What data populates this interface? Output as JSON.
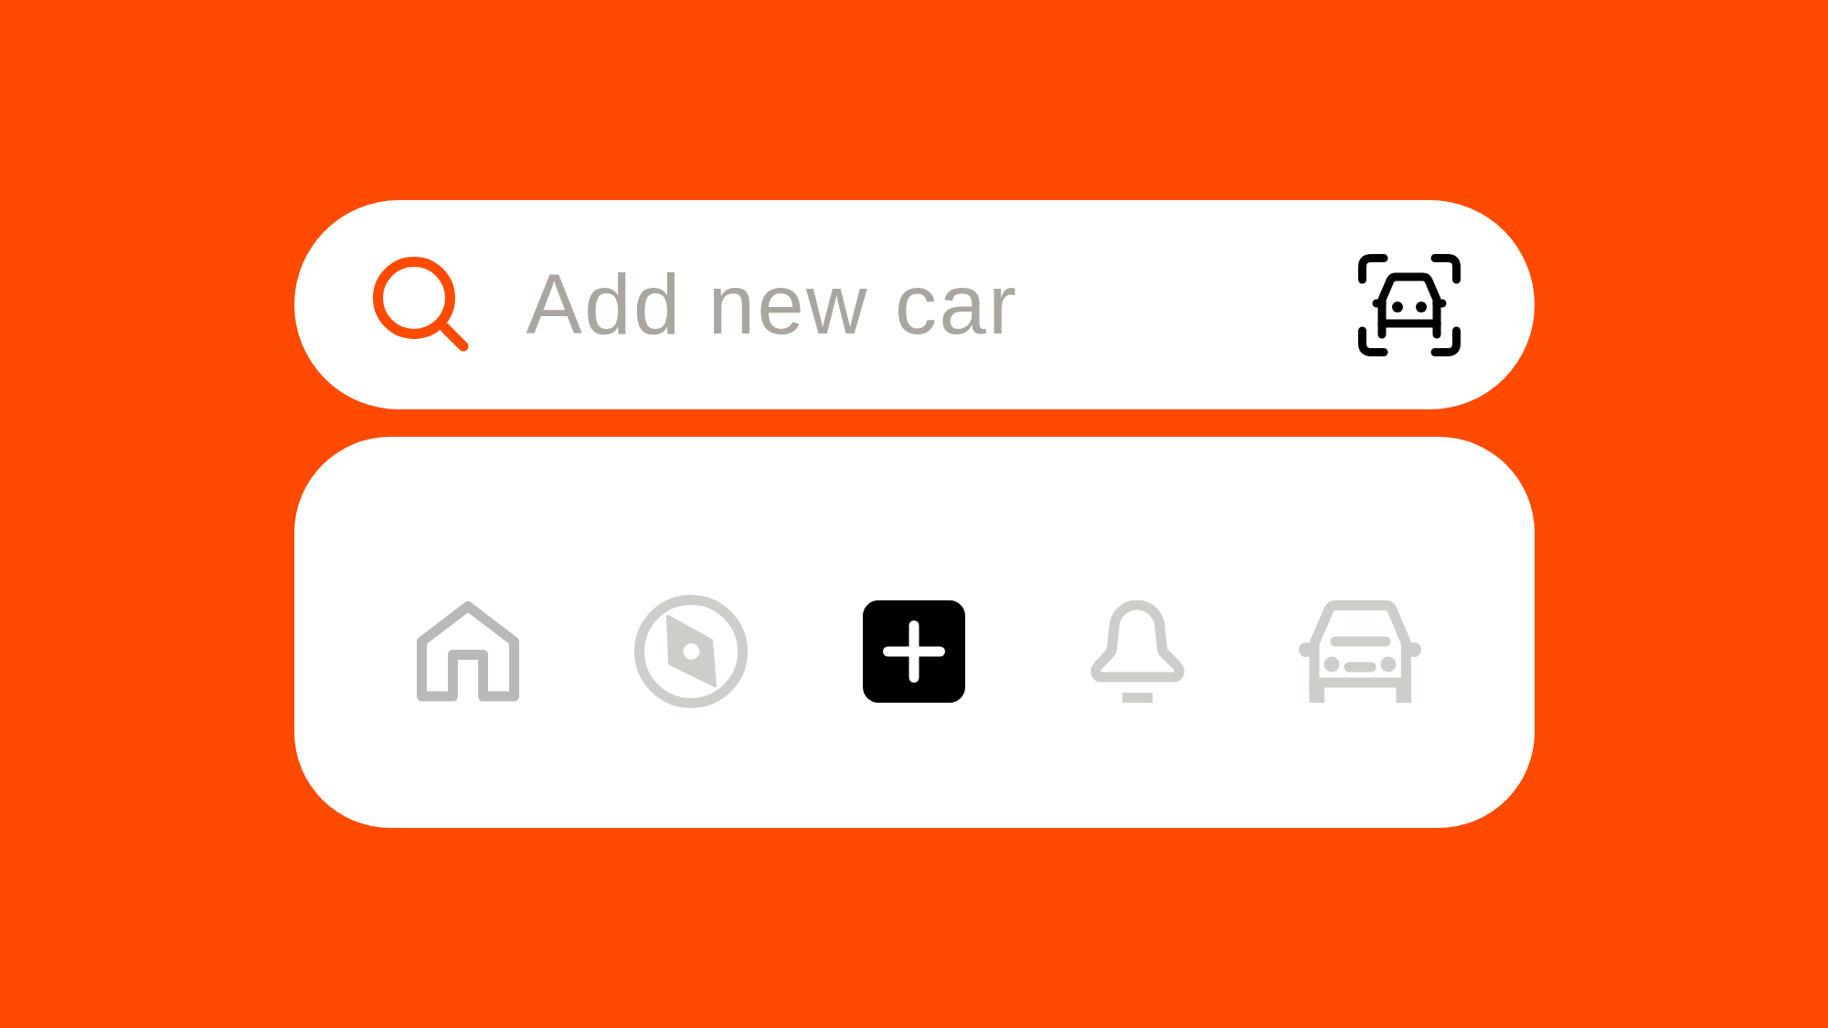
{
  "search": {
    "placeholder": "Add new car"
  },
  "tab_bar": {
    "items": [
      {
        "kind": "tab",
        "selected": true
      },
      {
        "kind": "tab",
        "selected": false
      },
      {
        "kind": "action"
      },
      {
        "kind": "tab",
        "selected": false
      },
      {
        "kind": "tab",
        "selected": false
      }
    ]
  }
}
